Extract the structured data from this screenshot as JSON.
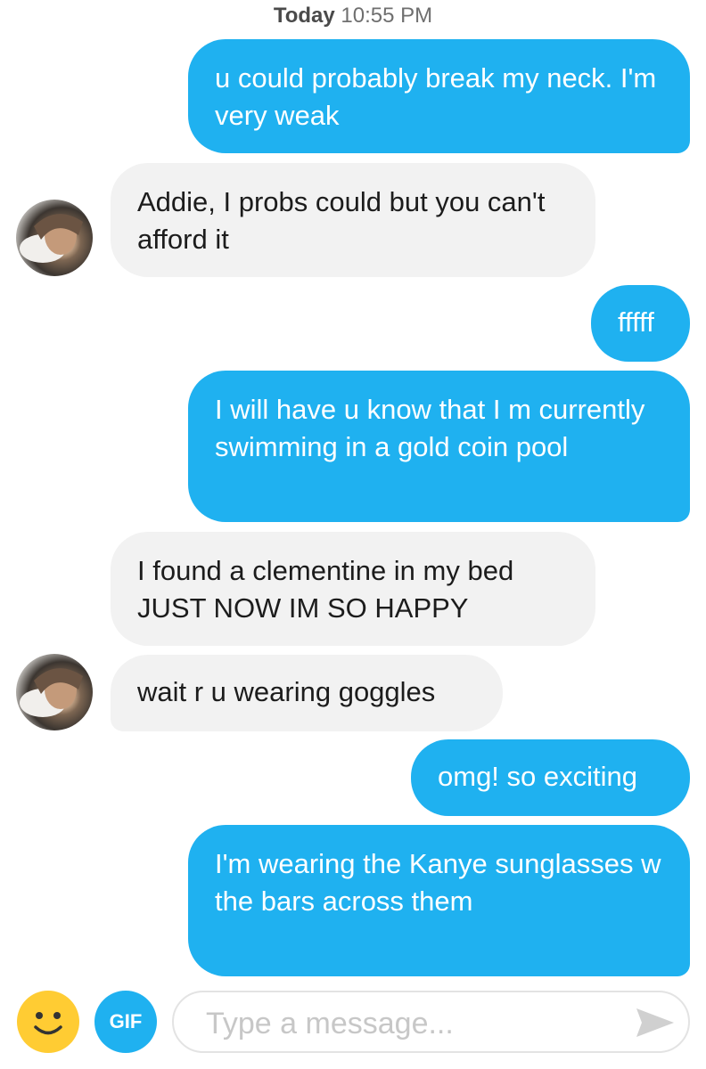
{
  "header": {
    "day": "Today",
    "time": "10:55 PM"
  },
  "messages": [
    {
      "side": "sent",
      "text": "u could probably break my neck. I'm very weak"
    },
    {
      "side": "received",
      "text": "Addie, I probs could but you can't afford it"
    },
    {
      "side": "sent",
      "text": "fffff"
    },
    {
      "side": "sent",
      "text": "I will have u know that I m currently swimming in a gold coin pool"
    },
    {
      "side": "received",
      "text": "I found a clementine in my bed JUST NOW IM SO HAPPY"
    },
    {
      "side": "received",
      "text": "wait r u wearing goggles"
    },
    {
      "side": "sent",
      "text": "omg! so exciting"
    },
    {
      "side": "sent",
      "text": "I'm wearing the Kanye sunglasses w the bars across them"
    }
  ],
  "composer": {
    "emoji_icon": "smiley-face-icon",
    "gif_label": "GIF",
    "placeholder": "Type a message...",
    "send_icon": "send-arrow-icon"
  },
  "colors": {
    "sent_bubble": "#1fb1f0",
    "received_bubble": "#f2f2f2",
    "emoji_button": "#ffcc33",
    "gif_button": "#1fb1f0"
  }
}
